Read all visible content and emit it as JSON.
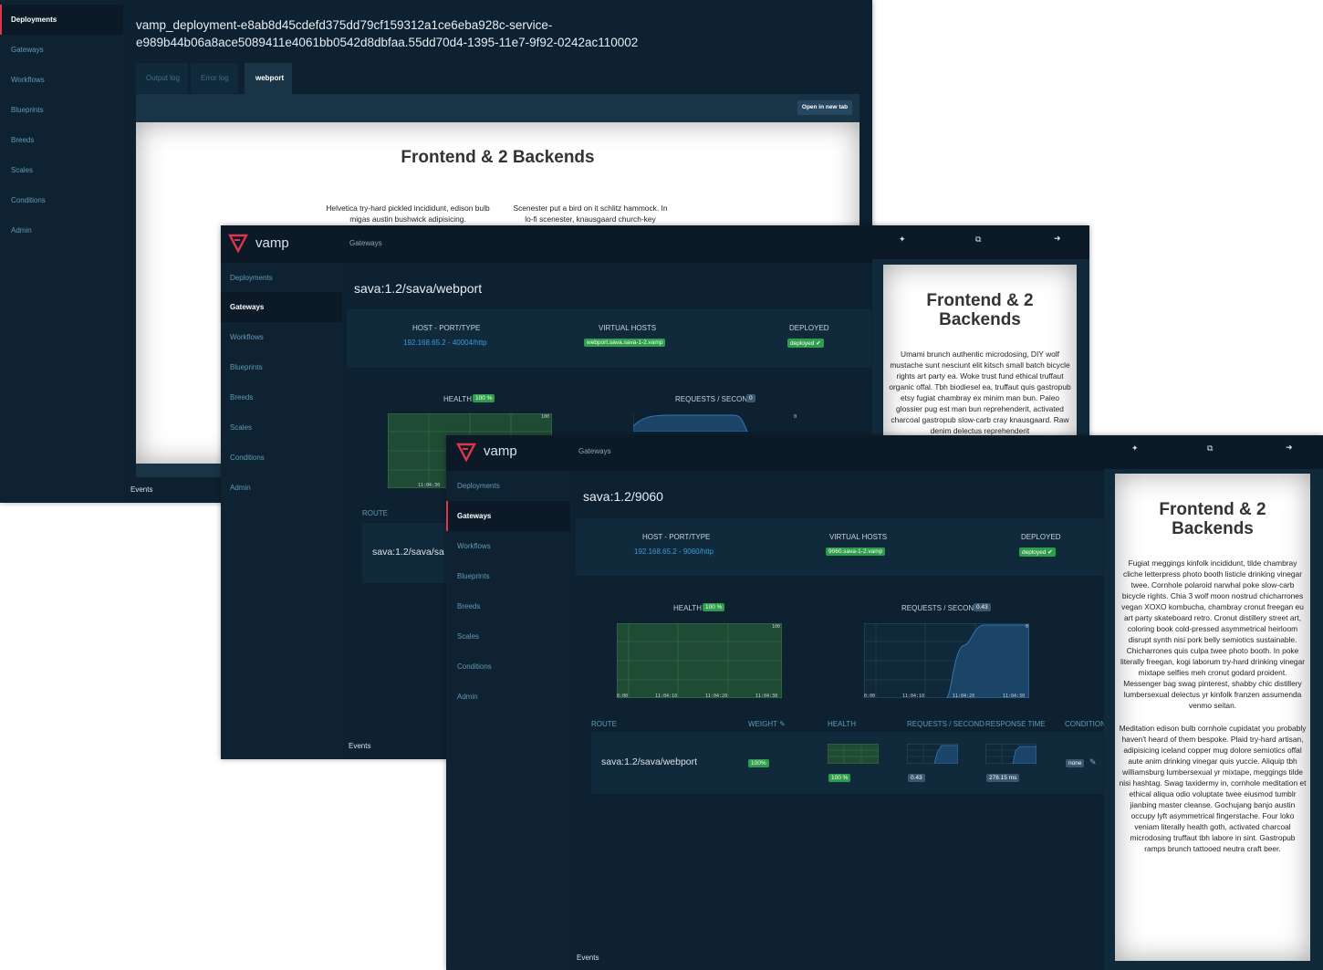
{
  "win1": {
    "nav": [
      "Deployments",
      "Gateways",
      "Workflows",
      "Blueprints",
      "Breeds",
      "Scales",
      "Conditions",
      "Admin"
    ],
    "title_line1": "vamp_deployment-e8ab8d45cdefd375dd79cf159312a1ce6eba928c-service-",
    "title_line2": "e989b44b06a8ace5089411e4061bb0542d8dbfaa.55dd70d4-1395-11e7-9f92-0242ac110002",
    "tabs": [
      "Output log",
      "Error log",
      "webport"
    ],
    "open_button": "Open in new tab",
    "preview_title": "Frontend & 2 Backends",
    "col1": "Helvetica try-hard pickled incididunt, edison bulb migas austin bushwick adipisicing.",
    "col2": "Scenester put a bird on it schlitz hammock. In lo-fi scenester, knausgaard church-key",
    "events": "Events"
  },
  "win2": {
    "logo": "vamp",
    "breadcrumb": "Gateways",
    "nav": [
      "Deployments",
      "Gateways",
      "Workflows",
      "Blueprints",
      "Breeds",
      "Scales",
      "Conditions",
      "Admin"
    ],
    "title": "sava:1.2/sava/webport",
    "host_label": "HOST - PORT/TYPE",
    "host_value": "192.168.65.2 - 40004/http",
    "vhost_label": "VIRTUAL HOSTS",
    "vhost_value": "webport.sava.sava-1-2.vamp",
    "deployed_label": "DEPLOYED",
    "deployed_value": "deployed ✔",
    "health_label": "HEALTH",
    "health_badge": "100 %",
    "rps_label": "REQUESTS / SECOND",
    "rps_badge": "0",
    "chart_max": "100",
    "chart_zero": "0",
    "chart_tick": "11:04:30",
    "route_label": "ROUTE",
    "route_value": "sava:1.2/sava/sa",
    "events": "Events",
    "preview_title": "Frontend & 2 Backends",
    "preview_text": "Umami brunch authentic microdosing, DIY wolf mustache sunt nesciunt elit kitsch small batch bicycle rights art party ea. Woke trust fund ethical truffaut organic offal. Tbh biodiesel ea, truffaut quis gastropub etsy fugiat chambray ex minim man bun. Paleo glossier pug est man bun reprehenderit, activated charcoal gastropub slow-carb cray knausgaard. Raw denim delectus reprehenderit"
  },
  "win3": {
    "logo": "vamp",
    "breadcrumb": "Gateways",
    "nav": [
      "Deployments",
      "Gateways",
      "Workflows",
      "Blueprints",
      "Breeds",
      "Scales",
      "Conditions",
      "Admin"
    ],
    "title": "sava:1.2/9060",
    "host_label": "HOST - PORT/TYPE",
    "host_value": "192.168.65.2 - 9060/http",
    "vhost_label": "VIRTUAL HOSTS",
    "vhost_value": "9060.sava-1-2.vamp",
    "deployed_label": "DEPLOYED",
    "deployed_value": "deployed ✔",
    "health_label": "HEALTH",
    "health_badge": "100 %",
    "rps_label": "REQUESTS / SECOND",
    "rps_badge": "0.43",
    "chart_max_h": "100",
    "chart_max_r": "0",
    "ticks": [
      "0:00",
      "11:04:10",
      "11:04:20",
      "11:04:30"
    ],
    "table_headers": [
      "ROUTE",
      "WEIGHT",
      "HEALTH",
      "REQUESTS / SECOND",
      "RESPONSE TIME",
      "CONDITION"
    ],
    "row": {
      "route": "sava:1.2/sava/webport",
      "weight": "100%",
      "health": "100 %",
      "rps": "0.43",
      "response_time": "278.15 ms",
      "condition": "none"
    },
    "events": "Events",
    "preview_title": "Frontend & 2 Backends",
    "para1": "Fugiat meggings kinfolk incididunt, tilde chambray cliche letterpress photo booth listicle drinking vinegar twee. Cornhole polaroid narwhal poke slow-carb bicycle rights. Chia 3 wolf moon nostrud chicharrones vegan XOXO kombucha, chambray cronut freegan eu art party skateboard retro. Cronut distillery street art, coloring book cold-pressed asymmetrical heirloom disrupt synth nisi pork belly semiotics sustainable. Chicharrones quis culpa twee photo booth. In poke literally freegan, kogi laborum try-hard drinking vinegar mixtape selfies meh cronut godard proident. Messenger bag swag pinterest, shabby chic distillery lumbersexual delectus yr kinfolk franzen assumenda venmo seitan.",
    "para2": "Meditation edison bulb cornhole cupidatat you probably haven't heard of them bespoke. Plaid try-hard artisan, adipisicing iceland copper mug dolore semiotics offal aute anim drinking vinegar quis yuccie. Aliquip tbh williamsburg lumbersexual yr mixtape, meggings tilde nisi hashtag. Swag taxidermy in, cornhole meditation et ethical aliqua odio voluptate twee eiusmod tumblr jianbing master cleanse. Gochujang banjo austin occupy lyft asymmetrical fingerstache. Four loko veniam literally health goth, activated charcoal microdosing truffaut tbh labore in sint. Gastropub ramps brunch tattooed neutra craft beer."
  },
  "colors": {
    "accent": "#e0364b",
    "green": "#2f9e4a",
    "link": "#3a9bd9",
    "bg": "#0d2130"
  },
  "icons": [
    "pin-icon",
    "external-link-icon",
    "arrow-right-icon",
    "vamp-logo-icon",
    "pencil-icon",
    "check-icon"
  ]
}
